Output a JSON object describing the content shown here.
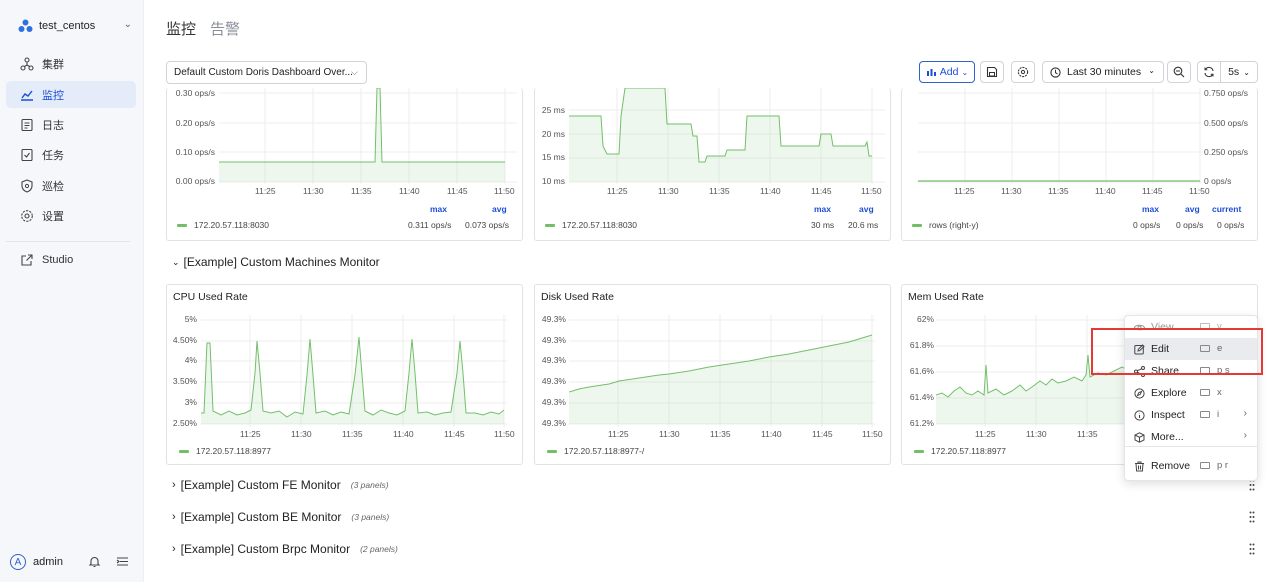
{
  "sidebar": {
    "cluster": "test_centos",
    "items": [
      {
        "label": "集群",
        "icon": "cluster-icon"
      },
      {
        "label": "监控",
        "icon": "monitor-icon"
      },
      {
        "label": "日志",
        "icon": "log-icon"
      },
      {
        "label": "任务",
        "icon": "task-icon"
      },
      {
        "label": "巡检",
        "icon": "inspect-icon"
      },
      {
        "label": "设置",
        "icon": "gear-icon"
      }
    ],
    "studio": "Studio",
    "user": "admin",
    "avatar_letter": "A"
  },
  "tabs": [
    "监控",
    "告警"
  ],
  "toolbar": {
    "dashboard": "Default Custom Doris Dashboard Over...",
    "add": "Add",
    "time_range": "Last 30 minutes",
    "refresh": "5s"
  },
  "top_panels": [
    {
      "y_ticks": [
        "0.30 ops/s",
        "0.20 ops/s",
        "0.10 ops/s",
        "0.00 ops/s"
      ],
      "x_ticks": [
        "11:25",
        "11:30",
        "11:35",
        "11:40",
        "11:45",
        "11:50"
      ],
      "legend_heads": [
        "max",
        "avg"
      ],
      "series": "172.20.57.118:8030",
      "values": [
        "0.311 ops/s",
        "0.073 ops/s"
      ]
    },
    {
      "y_ticks": [
        "25 ms",
        "20 ms",
        "15 ms",
        "10 ms"
      ],
      "x_ticks": [
        "11:25",
        "11:30",
        "11:35",
        "11:40",
        "11:45",
        "11:50"
      ],
      "legend_heads": [
        "max",
        "avg"
      ],
      "series": "172.20.57.118:8030",
      "values": [
        "30 ms",
        "20.6 ms"
      ]
    },
    {
      "y_ticks": [
        "0.750 ops/s",
        "0.500 ops/s",
        "0.250 ops/s",
        "0 ops/s"
      ],
      "x_ticks": [
        "11:25",
        "11:30",
        "11:35",
        "11:40",
        "11:45",
        "11:50"
      ],
      "legend_heads": [
        "max",
        "avg",
        "current"
      ],
      "series": "rows (right-y)",
      "values": [
        "0 ops/s",
        "0 ops/s",
        "0 ops/s"
      ]
    }
  ],
  "machines_row": "[Example] Custom Machines Monitor",
  "cpu": {
    "title": "CPU Used Rate",
    "y_ticks": [
      "5%",
      "4.50%",
      "4%",
      "3.50%",
      "3%",
      "2.50%"
    ],
    "x_ticks": [
      "11:25",
      "11:30",
      "11:35",
      "11:40",
      "11:45",
      "11:50"
    ],
    "series": "172.20.57.118:8977"
  },
  "disk": {
    "title": "Disk Used Rate",
    "y_ticks": [
      "49.3%",
      "49.3%",
      "49.3%",
      "49.3%",
      "49.3%",
      "49.3%"
    ],
    "x_ticks": [
      "11:25",
      "11:30",
      "11:35",
      "11:40",
      "11:45",
      "11:50"
    ],
    "series": "172.20.57.118:8977-/"
  },
  "mem": {
    "title": "Mem Used Rate",
    "y_ticks": [
      "62%",
      "61.8%",
      "61.6%",
      "61.4%",
      "61.2%"
    ],
    "x_ticks": [
      "11:25",
      "11:30",
      "11:35"
    ],
    "series": "172.20.57.118:8977"
  },
  "menu": [
    {
      "label": "View",
      "shortcut": "v",
      "icon": "eye-icon"
    },
    {
      "label": "Edit",
      "shortcut": "e",
      "icon": "edit-icon"
    },
    {
      "label": "Share",
      "shortcut": "p s",
      "icon": "share-icon"
    },
    {
      "label": "Explore",
      "shortcut": "x",
      "icon": "compass-icon"
    },
    {
      "label": "Inspect",
      "shortcut": "i",
      "icon": "info-icon"
    },
    {
      "label": "More...",
      "shortcut": "",
      "icon": "cube-icon"
    },
    {
      "label": "Remove",
      "shortcut": "p r",
      "icon": "trash-icon"
    }
  ],
  "rows": [
    {
      "title": "[Example] Custom FE Monitor",
      "count": "(3 panels)"
    },
    {
      "title": "[Example] Custom BE Monitor",
      "count": "(3 panels)"
    },
    {
      "title": "[Example] Custom Brpc Monitor",
      "count": "(2 panels)"
    }
  ]
}
